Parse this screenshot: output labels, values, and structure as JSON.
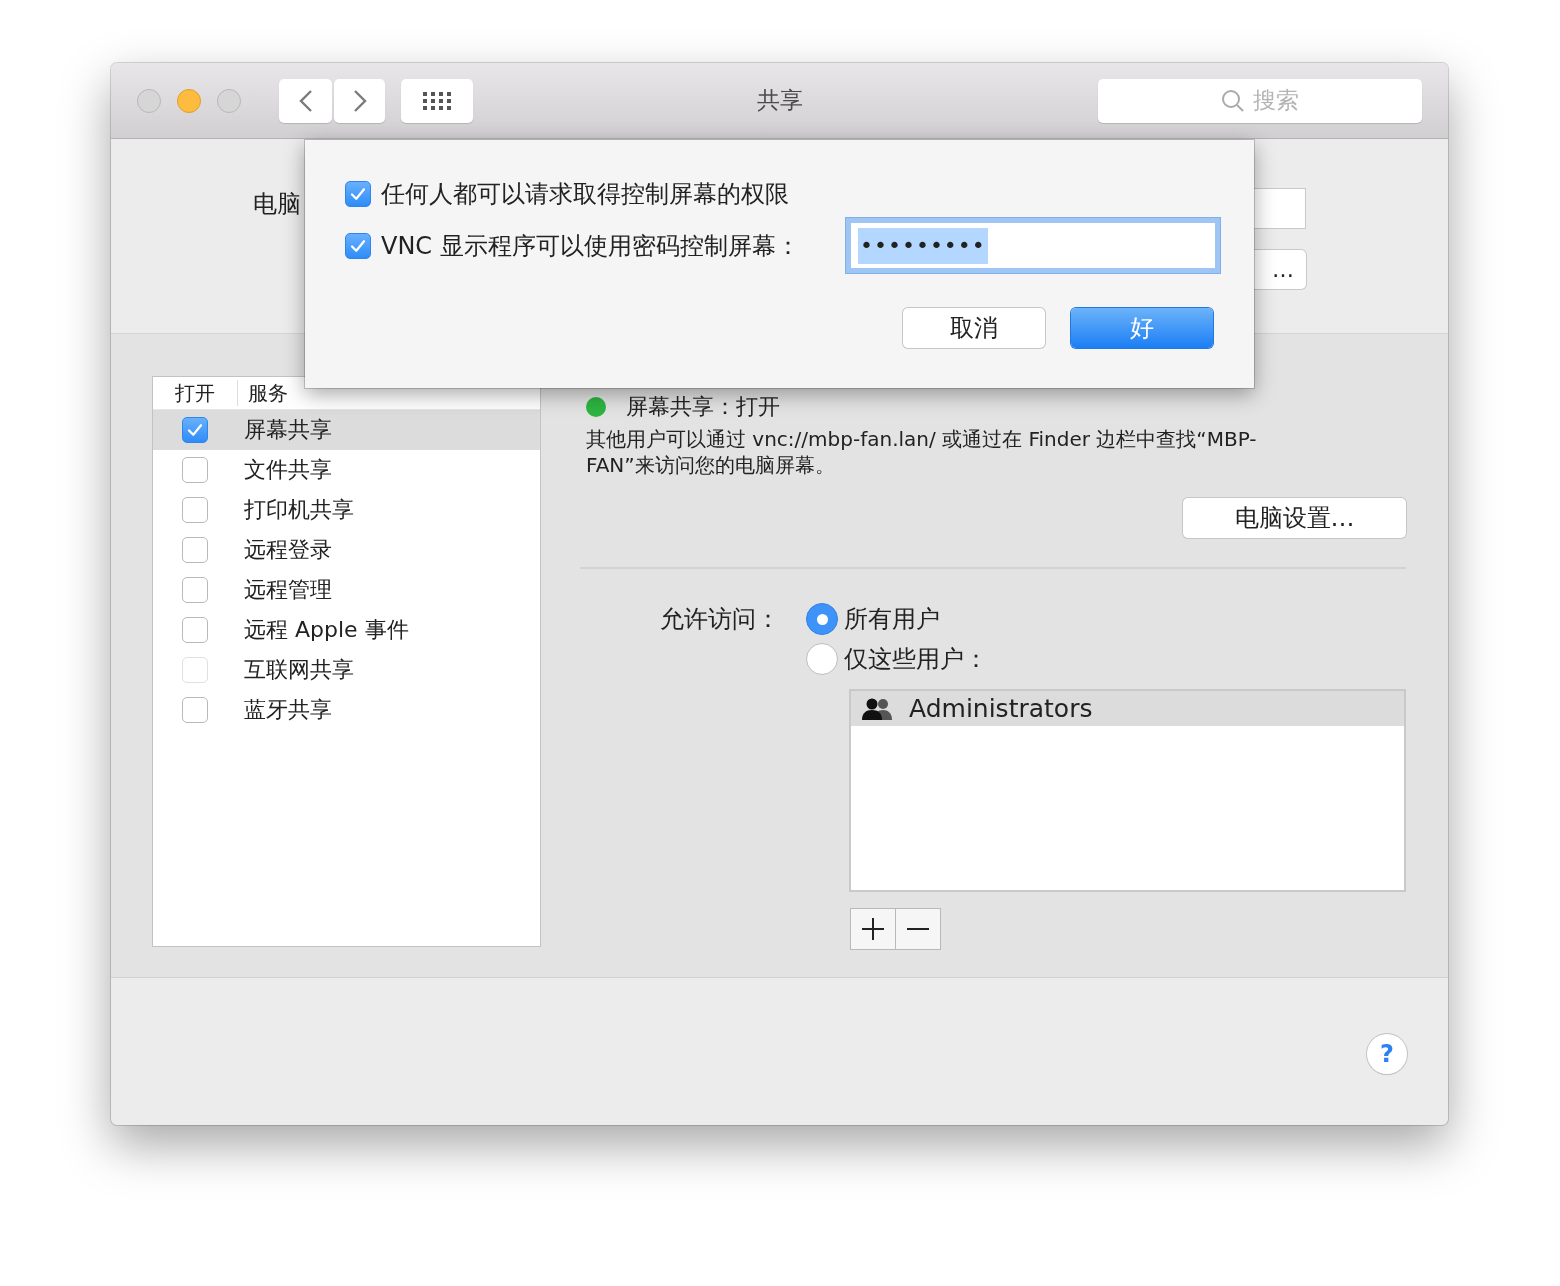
{
  "window": {
    "title": "共享",
    "search": {
      "placeholder": "搜索"
    }
  },
  "computer_name": {
    "label": "电脑",
    "edit_button": "…"
  },
  "services": {
    "columns": [
      "打开",
      "服务"
    ],
    "items": [
      {
        "name": "屏幕共享",
        "checked": true,
        "selected": true,
        "disabled": false
      },
      {
        "name": "文件共享",
        "checked": false,
        "selected": false,
        "disabled": false
      },
      {
        "name": "打印机共享",
        "checked": false,
        "selected": false,
        "disabled": false
      },
      {
        "name": "远程登录",
        "checked": false,
        "selected": false,
        "disabled": false
      },
      {
        "name": "远程管理",
        "checked": false,
        "selected": false,
        "disabled": false
      },
      {
        "name": "远程 Apple 事件",
        "checked": false,
        "selected": false,
        "disabled": false
      },
      {
        "name": "互联网共享",
        "checked": false,
        "selected": false,
        "disabled": true
      },
      {
        "name": "蓝牙共享",
        "checked": false,
        "selected": false,
        "disabled": false
      }
    ]
  },
  "detail": {
    "status": "屏幕共享：打开",
    "status_on": true,
    "description": "其他用户可以通过 vnc://mbp-fan.lan/ 或通过在 Finder 边栏中查找“MBP-FAN”来访问您的电脑屏幕。",
    "settings_button": "电脑设置…"
  },
  "access": {
    "label": "允许访问：",
    "options": [
      {
        "label": "所有用户",
        "selected": true
      },
      {
        "label": "仅这些用户：",
        "selected": false
      }
    ],
    "users": [
      {
        "name": "Administrators",
        "selected": true
      }
    ]
  },
  "help_button": "?",
  "dialog": {
    "options": [
      {
        "label": "任何人都可以请求取得控制屏幕的权限",
        "checked": true
      },
      {
        "label": "VNC 显示程序可以使用密码控制屏幕：",
        "checked": true
      }
    ],
    "password": "•••••••••",
    "buttons": [
      {
        "label": "取消",
        "default": false
      },
      {
        "label": "好",
        "default": true
      }
    ]
  }
}
